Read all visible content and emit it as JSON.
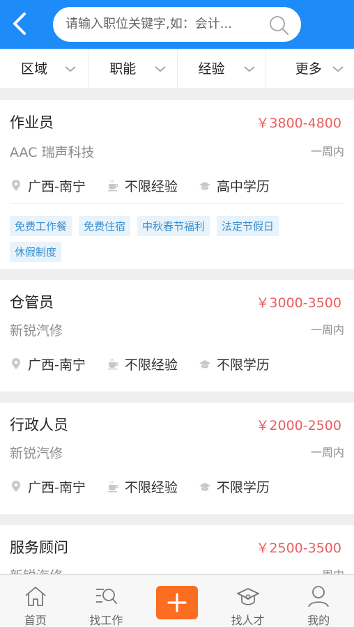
{
  "header": {
    "search_placeholder": "请输入职位关键字,如：会计..."
  },
  "filters": [
    "区域",
    "职能",
    "经验",
    "更多"
  ],
  "jobs": [
    {
      "title": "作业员",
      "salary": "￥3800-4800",
      "company": "AAC 瑞声科技",
      "date": "一周内",
      "location": "广西-南宁",
      "experience": "不限经验",
      "education": "高中学历",
      "tags": [
        "免费工作餐",
        "免费住宿",
        "中秋春节福利",
        "法定节假日",
        "休假制度"
      ]
    },
    {
      "title": "仓管员",
      "salary": "￥3000-3500",
      "company": "新锐汽修",
      "date": "一周内",
      "location": "广西-南宁",
      "experience": "不限经验",
      "education": "不限学历"
    },
    {
      "title": "行政人员",
      "salary": "￥2000-2500",
      "company": "新锐汽修",
      "date": "一周内",
      "location": "广西-南宁",
      "experience": "不限经验",
      "education": "不限学历"
    },
    {
      "title": "服务顾问",
      "salary": "￥2500-3500",
      "company": "新锐汽修",
      "date": "一周内"
    }
  ],
  "bottom_nav": {
    "home": "首页",
    "find_job": "找工作",
    "find_talent": "找人才",
    "mine": "我的"
  },
  "colors": {
    "primary": "#1d8cf8",
    "salary": "#ea5d5d",
    "tag_text": "#3a8fd0",
    "tag_bg": "#e8f3fb",
    "add_button": "#fb6d20"
  },
  "icons": [
    "back-arrow-icon",
    "search-icon",
    "chevron-down-icon",
    "location-pin-icon",
    "coffee-cup-icon",
    "graduation-cap-icon",
    "home-icon",
    "find-job-icon",
    "plus-icon",
    "find-talent-icon",
    "user-icon"
  ]
}
